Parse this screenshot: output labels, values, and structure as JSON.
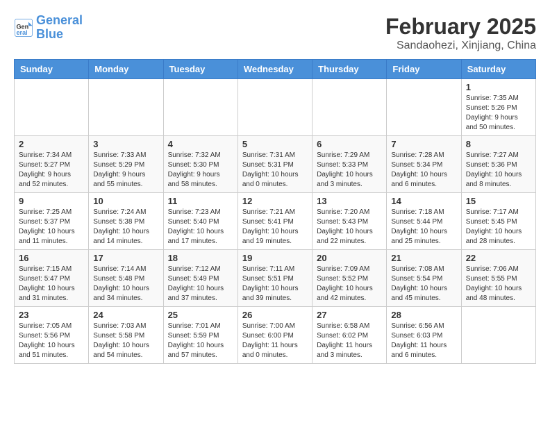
{
  "header": {
    "logo_line1": "General",
    "logo_line2": "Blue",
    "main_title": "February 2025",
    "subtitle": "Sandaohezi, Xinjiang, China"
  },
  "days_of_week": [
    "Sunday",
    "Monday",
    "Tuesday",
    "Wednesday",
    "Thursday",
    "Friday",
    "Saturday"
  ],
  "weeks": [
    [
      {
        "day": "",
        "info": ""
      },
      {
        "day": "",
        "info": ""
      },
      {
        "day": "",
        "info": ""
      },
      {
        "day": "",
        "info": ""
      },
      {
        "day": "",
        "info": ""
      },
      {
        "day": "",
        "info": ""
      },
      {
        "day": "1",
        "info": "Sunrise: 7:35 AM\nSunset: 5:26 PM\nDaylight: 9 hours and 50 minutes."
      }
    ],
    [
      {
        "day": "2",
        "info": "Sunrise: 7:34 AM\nSunset: 5:27 PM\nDaylight: 9 hours and 52 minutes."
      },
      {
        "day": "3",
        "info": "Sunrise: 7:33 AM\nSunset: 5:29 PM\nDaylight: 9 hours and 55 minutes."
      },
      {
        "day": "4",
        "info": "Sunrise: 7:32 AM\nSunset: 5:30 PM\nDaylight: 9 hours and 58 minutes."
      },
      {
        "day": "5",
        "info": "Sunrise: 7:31 AM\nSunset: 5:31 PM\nDaylight: 10 hours and 0 minutes."
      },
      {
        "day": "6",
        "info": "Sunrise: 7:29 AM\nSunset: 5:33 PM\nDaylight: 10 hours and 3 minutes."
      },
      {
        "day": "7",
        "info": "Sunrise: 7:28 AM\nSunset: 5:34 PM\nDaylight: 10 hours and 6 minutes."
      },
      {
        "day": "8",
        "info": "Sunrise: 7:27 AM\nSunset: 5:36 PM\nDaylight: 10 hours and 8 minutes."
      }
    ],
    [
      {
        "day": "9",
        "info": "Sunrise: 7:25 AM\nSunset: 5:37 PM\nDaylight: 10 hours and 11 minutes."
      },
      {
        "day": "10",
        "info": "Sunrise: 7:24 AM\nSunset: 5:38 PM\nDaylight: 10 hours and 14 minutes."
      },
      {
        "day": "11",
        "info": "Sunrise: 7:23 AM\nSunset: 5:40 PM\nDaylight: 10 hours and 17 minutes."
      },
      {
        "day": "12",
        "info": "Sunrise: 7:21 AM\nSunset: 5:41 PM\nDaylight: 10 hours and 19 minutes."
      },
      {
        "day": "13",
        "info": "Sunrise: 7:20 AM\nSunset: 5:43 PM\nDaylight: 10 hours and 22 minutes."
      },
      {
        "day": "14",
        "info": "Sunrise: 7:18 AM\nSunset: 5:44 PM\nDaylight: 10 hours and 25 minutes."
      },
      {
        "day": "15",
        "info": "Sunrise: 7:17 AM\nSunset: 5:45 PM\nDaylight: 10 hours and 28 minutes."
      }
    ],
    [
      {
        "day": "16",
        "info": "Sunrise: 7:15 AM\nSunset: 5:47 PM\nDaylight: 10 hours and 31 minutes."
      },
      {
        "day": "17",
        "info": "Sunrise: 7:14 AM\nSunset: 5:48 PM\nDaylight: 10 hours and 34 minutes."
      },
      {
        "day": "18",
        "info": "Sunrise: 7:12 AM\nSunset: 5:49 PM\nDaylight: 10 hours and 37 minutes."
      },
      {
        "day": "19",
        "info": "Sunrise: 7:11 AM\nSunset: 5:51 PM\nDaylight: 10 hours and 39 minutes."
      },
      {
        "day": "20",
        "info": "Sunrise: 7:09 AM\nSunset: 5:52 PM\nDaylight: 10 hours and 42 minutes."
      },
      {
        "day": "21",
        "info": "Sunrise: 7:08 AM\nSunset: 5:54 PM\nDaylight: 10 hours and 45 minutes."
      },
      {
        "day": "22",
        "info": "Sunrise: 7:06 AM\nSunset: 5:55 PM\nDaylight: 10 hours and 48 minutes."
      }
    ],
    [
      {
        "day": "23",
        "info": "Sunrise: 7:05 AM\nSunset: 5:56 PM\nDaylight: 10 hours and 51 minutes."
      },
      {
        "day": "24",
        "info": "Sunrise: 7:03 AM\nSunset: 5:58 PM\nDaylight: 10 hours and 54 minutes."
      },
      {
        "day": "25",
        "info": "Sunrise: 7:01 AM\nSunset: 5:59 PM\nDaylight: 10 hours and 57 minutes."
      },
      {
        "day": "26",
        "info": "Sunrise: 7:00 AM\nSunset: 6:00 PM\nDaylight: 11 hours and 0 minutes."
      },
      {
        "day": "27",
        "info": "Sunrise: 6:58 AM\nSunset: 6:02 PM\nDaylight: 11 hours and 3 minutes."
      },
      {
        "day": "28",
        "info": "Sunrise: 6:56 AM\nSunset: 6:03 PM\nDaylight: 11 hours and 6 minutes."
      },
      {
        "day": "",
        "info": ""
      }
    ]
  ]
}
